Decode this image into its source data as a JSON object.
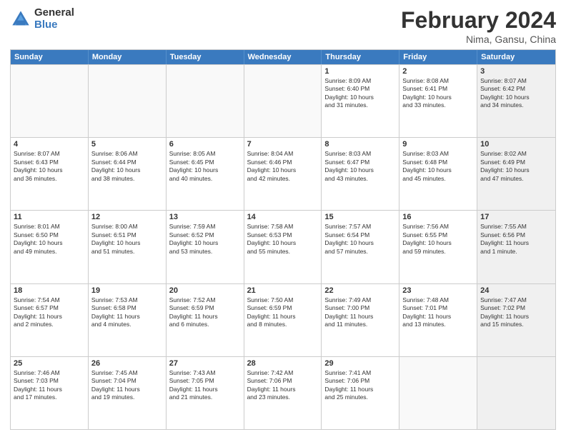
{
  "header": {
    "logo_general": "General",
    "logo_blue": "Blue",
    "title": "February 2024",
    "location": "Nima, Gansu, China"
  },
  "weekdays": [
    "Sunday",
    "Monday",
    "Tuesday",
    "Wednesday",
    "Thursday",
    "Friday",
    "Saturday"
  ],
  "rows": [
    [
      {
        "day": "",
        "info": "",
        "empty": true
      },
      {
        "day": "",
        "info": "",
        "empty": true
      },
      {
        "day": "",
        "info": "",
        "empty": true
      },
      {
        "day": "",
        "info": "",
        "empty": true
      },
      {
        "day": "1",
        "info": "Sunrise: 8:09 AM\nSunset: 6:40 PM\nDaylight: 10 hours\nand 31 minutes.",
        "empty": false
      },
      {
        "day": "2",
        "info": "Sunrise: 8:08 AM\nSunset: 6:41 PM\nDaylight: 10 hours\nand 33 minutes.",
        "empty": false
      },
      {
        "day": "3",
        "info": "Sunrise: 8:07 AM\nSunset: 6:42 PM\nDaylight: 10 hours\nand 34 minutes.",
        "empty": false,
        "shaded": true
      }
    ],
    [
      {
        "day": "4",
        "info": "Sunrise: 8:07 AM\nSunset: 6:43 PM\nDaylight: 10 hours\nand 36 minutes.",
        "empty": false
      },
      {
        "day": "5",
        "info": "Sunrise: 8:06 AM\nSunset: 6:44 PM\nDaylight: 10 hours\nand 38 minutes.",
        "empty": false
      },
      {
        "day": "6",
        "info": "Sunrise: 8:05 AM\nSunset: 6:45 PM\nDaylight: 10 hours\nand 40 minutes.",
        "empty": false
      },
      {
        "day": "7",
        "info": "Sunrise: 8:04 AM\nSunset: 6:46 PM\nDaylight: 10 hours\nand 42 minutes.",
        "empty": false
      },
      {
        "day": "8",
        "info": "Sunrise: 8:03 AM\nSunset: 6:47 PM\nDaylight: 10 hours\nand 43 minutes.",
        "empty": false
      },
      {
        "day": "9",
        "info": "Sunrise: 8:03 AM\nSunset: 6:48 PM\nDaylight: 10 hours\nand 45 minutes.",
        "empty": false
      },
      {
        "day": "10",
        "info": "Sunrise: 8:02 AM\nSunset: 6:49 PM\nDaylight: 10 hours\nand 47 minutes.",
        "empty": false,
        "shaded": true
      }
    ],
    [
      {
        "day": "11",
        "info": "Sunrise: 8:01 AM\nSunset: 6:50 PM\nDaylight: 10 hours\nand 49 minutes.",
        "empty": false
      },
      {
        "day": "12",
        "info": "Sunrise: 8:00 AM\nSunset: 6:51 PM\nDaylight: 10 hours\nand 51 minutes.",
        "empty": false
      },
      {
        "day": "13",
        "info": "Sunrise: 7:59 AM\nSunset: 6:52 PM\nDaylight: 10 hours\nand 53 minutes.",
        "empty": false
      },
      {
        "day": "14",
        "info": "Sunrise: 7:58 AM\nSunset: 6:53 PM\nDaylight: 10 hours\nand 55 minutes.",
        "empty": false
      },
      {
        "day": "15",
        "info": "Sunrise: 7:57 AM\nSunset: 6:54 PM\nDaylight: 10 hours\nand 57 minutes.",
        "empty": false
      },
      {
        "day": "16",
        "info": "Sunrise: 7:56 AM\nSunset: 6:55 PM\nDaylight: 10 hours\nand 59 minutes.",
        "empty": false
      },
      {
        "day": "17",
        "info": "Sunrise: 7:55 AM\nSunset: 6:56 PM\nDaylight: 11 hours\nand 1 minute.",
        "empty": false,
        "shaded": true
      }
    ],
    [
      {
        "day": "18",
        "info": "Sunrise: 7:54 AM\nSunset: 6:57 PM\nDaylight: 11 hours\nand 2 minutes.",
        "empty": false
      },
      {
        "day": "19",
        "info": "Sunrise: 7:53 AM\nSunset: 6:58 PM\nDaylight: 11 hours\nand 4 minutes.",
        "empty": false
      },
      {
        "day": "20",
        "info": "Sunrise: 7:52 AM\nSunset: 6:59 PM\nDaylight: 11 hours\nand 6 minutes.",
        "empty": false
      },
      {
        "day": "21",
        "info": "Sunrise: 7:50 AM\nSunset: 6:59 PM\nDaylight: 11 hours\nand 8 minutes.",
        "empty": false
      },
      {
        "day": "22",
        "info": "Sunrise: 7:49 AM\nSunset: 7:00 PM\nDaylight: 11 hours\nand 11 minutes.",
        "empty": false
      },
      {
        "day": "23",
        "info": "Sunrise: 7:48 AM\nSunset: 7:01 PM\nDaylight: 11 hours\nand 13 minutes.",
        "empty": false
      },
      {
        "day": "24",
        "info": "Sunrise: 7:47 AM\nSunset: 7:02 PM\nDaylight: 11 hours\nand 15 minutes.",
        "empty": false,
        "shaded": true
      }
    ],
    [
      {
        "day": "25",
        "info": "Sunrise: 7:46 AM\nSunset: 7:03 PM\nDaylight: 11 hours\nand 17 minutes.",
        "empty": false
      },
      {
        "day": "26",
        "info": "Sunrise: 7:45 AM\nSunset: 7:04 PM\nDaylight: 11 hours\nand 19 minutes.",
        "empty": false
      },
      {
        "day": "27",
        "info": "Sunrise: 7:43 AM\nSunset: 7:05 PM\nDaylight: 11 hours\nand 21 minutes.",
        "empty": false
      },
      {
        "day": "28",
        "info": "Sunrise: 7:42 AM\nSunset: 7:06 PM\nDaylight: 11 hours\nand 23 minutes.",
        "empty": false
      },
      {
        "day": "29",
        "info": "Sunrise: 7:41 AM\nSunset: 7:06 PM\nDaylight: 11 hours\nand 25 minutes.",
        "empty": false
      },
      {
        "day": "",
        "info": "",
        "empty": true
      },
      {
        "day": "",
        "info": "",
        "empty": true,
        "shaded": true
      }
    ]
  ]
}
